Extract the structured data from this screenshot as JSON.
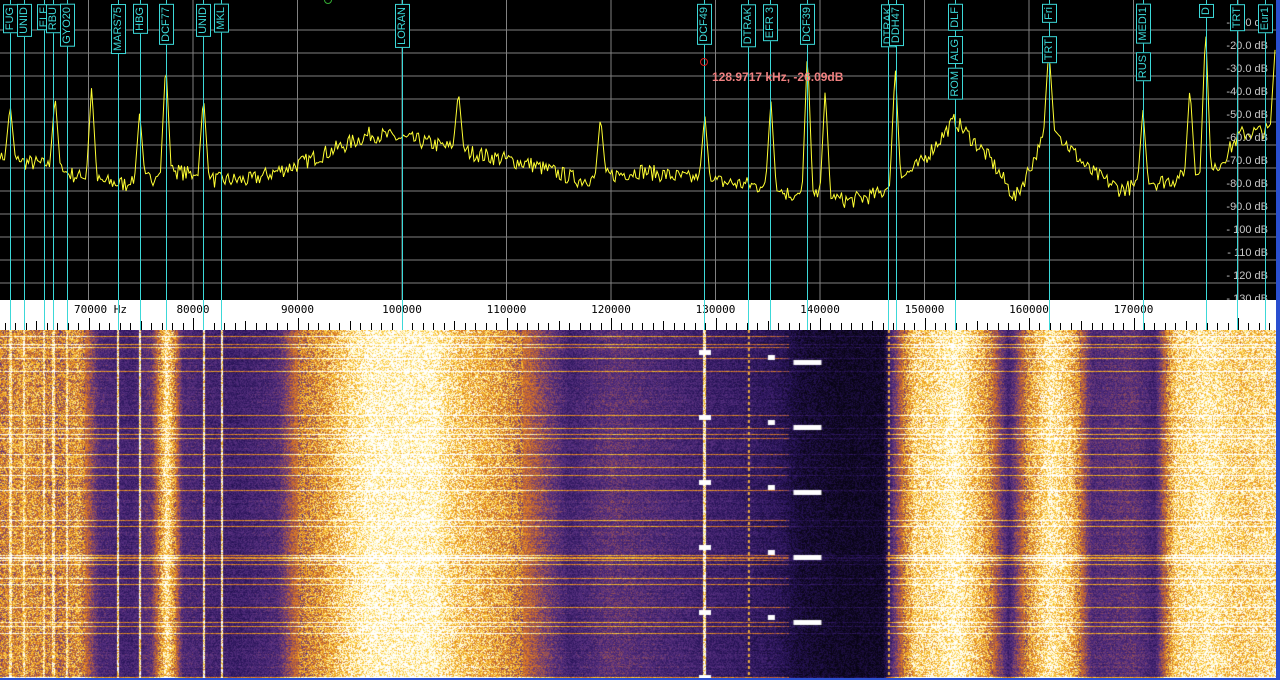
{
  "spectrum": {
    "db_labels": [
      "-10.0 dB",
      "-20.0 dB",
      "-30.0 dB",
      "-40.0 dB",
      "-50.0 dB",
      "-60.0 dB",
      "-70.0 dB",
      "-80.0 dB",
      "-90.0 dB",
      "- 100 dB",
      "- 110 dB",
      "- 120 dB",
      "- 130 dB"
    ],
    "db_values": [
      -10,
      -20,
      -30,
      -40,
      -50,
      -60,
      -70,
      -80,
      -90,
      -100,
      -110,
      -120,
      -130
    ],
    "baseline": [
      [
        61.5,
        -68
      ],
      [
        65.4,
        -70
      ],
      [
        70,
        -77
      ],
      [
        74,
        -79
      ],
      [
        78.3,
        -73
      ],
      [
        82.1,
        -77
      ],
      [
        85.5,
        -77
      ],
      [
        90.2,
        -70
      ],
      [
        97,
        -57
      ],
      [
        101.7,
        -60
      ],
      [
        107.5,
        -66
      ],
      [
        112.2,
        -70
      ],
      [
        117,
        -77
      ],
      [
        122.8,
        -73
      ],
      [
        128.5,
        -77
      ],
      [
        133.3,
        -79
      ],
      [
        137.1,
        -83
      ],
      [
        142.9,
        -86
      ],
      [
        145.7,
        -83
      ],
      [
        149.6,
        -70
      ],
      [
        152.9,
        -51
      ],
      [
        156.3,
        -68
      ],
      [
        158.7,
        -85
      ],
      [
        162,
        -53
      ],
      [
        165.8,
        -73
      ],
      [
        168.7,
        -81
      ],
      [
        173.5,
        -77
      ],
      [
        177.8,
        -73
      ],
      [
        180.2,
        -57
      ],
      [
        183.5,
        -55
      ]
    ],
    "peaks": [
      [
        62.5,
        -44
      ],
      [
        66.8,
        -40
      ],
      [
        70.3,
        -36
      ],
      [
        74.9,
        -47
      ],
      [
        77.4,
        -25
      ],
      [
        81,
        -40
      ],
      [
        105.4,
        -38
      ],
      [
        119,
        -49
      ],
      [
        128.97,
        -48
      ],
      [
        135.3,
        -42
      ],
      [
        138.8,
        -20
      ],
      [
        140.5,
        -37
      ],
      [
        147.2,
        -27
      ],
      [
        161.9,
        -20
      ],
      [
        170.9,
        -46
      ],
      [
        175.4,
        -36
      ],
      [
        176.9,
        -10
      ],
      [
        183.6,
        -16
      ]
    ],
    "trace_color": "#ffff33",
    "grid_color": "#808080"
  },
  "cursor": {
    "readout": "128.9717 kHz, -26.09dB",
    "freq_khz": 128.9717,
    "db": -26.09
  },
  "ruler": {
    "labels": [
      {
        "khz": 70,
        "text": "70000 Hz"
      },
      {
        "khz": 80,
        "text": "80000"
      },
      {
        "khz": 90,
        "text": "90000"
      },
      {
        "khz": 100,
        "text": "100000"
      },
      {
        "khz": 110,
        "text": "110000"
      },
      {
        "khz": 120,
        "text": "120000"
      },
      {
        "khz": 130,
        "text": "130000"
      },
      {
        "khz": 140,
        "text": "140000"
      },
      {
        "khz": 150,
        "text": "150000"
      },
      {
        "khz": 160,
        "text": "160000"
      },
      {
        "khz": 170,
        "text": "170000"
      }
    ]
  },
  "stations": [
    {
      "khz": 62.5,
      "labels": [
        "FUG"
      ]
    },
    {
      "khz": 63.8,
      "labels": [
        "UNID"
      ]
    },
    {
      "khz": 65.7,
      "labels": [
        "ELF"
      ]
    },
    {
      "khz": 66.6,
      "labels": [
        "RBU"
      ]
    },
    {
      "khz": 67.9,
      "labels": [
        "GYO20"
      ]
    },
    {
      "khz": 72.8,
      "labels": [
        "MARS75"
      ]
    },
    {
      "khz": 74.9,
      "labels": [
        "HBG"
      ]
    },
    {
      "khz": 77.4,
      "labels": [
        "DCF77"
      ]
    },
    {
      "khz": 81.0,
      "labels": [
        "UNID"
      ]
    },
    {
      "khz": 82.7,
      "labels": [
        "MKL"
      ]
    },
    {
      "khz": 100.0,
      "labels": [
        "LORAN"
      ]
    },
    {
      "khz": 128.9,
      "labels": [
        "DCF49"
      ]
    },
    {
      "khz": 133.1,
      "labels": [
        "DTRAK"
      ]
    },
    {
      "khz": 135.2,
      "labels": [
        "EFR 3"
      ]
    },
    {
      "khz": 138.8,
      "labels": [
        "DCF39"
      ]
    },
    {
      "khz": 146.5,
      "labels": [
        "DTRAK"
      ]
    },
    {
      "khz": 147.3,
      "labels": [
        "DDH47"
      ]
    },
    {
      "khz": 152.9,
      "labels": [
        "DLF",
        "ALG",
        "ROM"
      ]
    },
    {
      "khz": 161.9,
      "labels": [
        "Fri",
        "TRT"
      ]
    },
    {
      "khz": 170.9,
      "labels": [
        "MEDI1",
        "RUS"
      ]
    },
    {
      "khz": 176.9,
      "labels": [
        "D"
      ]
    },
    {
      "khz": 179.9,
      "labels": [
        "TRT"
      ]
    },
    {
      "khz": 182.6,
      "labels": [
        "Eur1"
      ]
    }
  ]
}
